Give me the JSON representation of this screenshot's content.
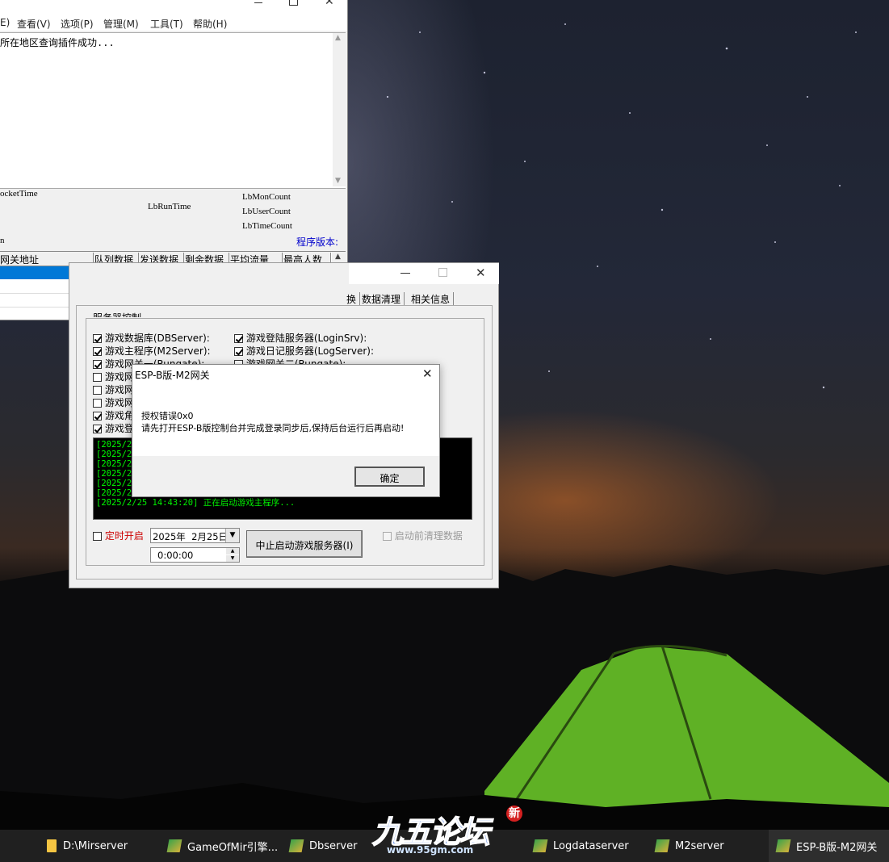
{
  "top_window": {
    "menu": [
      "E)",
      "查看(V)",
      "选项(P)",
      "管理(M)",
      "工具(T)",
      "帮助(H)"
    ],
    "log_line": "所在地区查询插件成功...",
    "info": {
      "socket_time": "ocketTime",
      "run_time": "LbRunTime",
      "mon_count": "LbMonCount",
      "user_count": "LbUserCount",
      "time_count": "LbTimeCount",
      "version_label": "程序版本:",
      "left_small": "n"
    },
    "table_headers": [
      "网关地址",
      "队列数据",
      "发送数据",
      "剩余数据",
      "平均流量",
      "最高人数"
    ]
  },
  "console_window": {
    "tabs": [
      "换",
      "数据清理",
      "相关信息"
    ],
    "group_title": "服务器控制",
    "left_checks": [
      {
        "label": "游戏数据库(DBServer):",
        "checked": true
      },
      {
        "label": "游戏主程序(M2Server):",
        "checked": true
      },
      {
        "label": "游戏网关一(Rungate):",
        "checked": true
      },
      {
        "label": "游戏网",
        "checked": false
      },
      {
        "label": "游戏网",
        "checked": false
      },
      {
        "label": "游戏网",
        "checked": false
      },
      {
        "label": "游戏角",
        "checked": true
      },
      {
        "label": "游戏登",
        "checked": true
      }
    ],
    "right_checks": [
      {
        "label": "游戏登陆服务器(LoginSrv):",
        "checked": true
      },
      {
        "label": "游戏日记服务器(LogServer):",
        "checked": true
      },
      {
        "label": "游戏网关二(Rungate):",
        "checked": false
      }
    ],
    "log_lines": [
      "[2025/2/",
      "[2025/2/",
      "[2025/2/",
      "[2025/2/",
      "[2025/2/",
      "[2025/2/",
      "[2025/2/25 14:43:20] 正在启动游戏主程序..."
    ],
    "timer_label": "定时开启",
    "date_value": "2025年  2月25日",
    "time_value": "0:00:00",
    "start_button": "中止启动游戏服务器(I)",
    "clear_label": "启动前清理数据"
  },
  "dialog": {
    "title": "ESP-B版-M2网关",
    "message_line1": "授权错误0x0",
    "message_line2": "请先打开ESP-B版控制台并完成登录同步后,保持后台运行后再启动!",
    "ok_button": "确定"
  },
  "taskbar": {
    "items": [
      {
        "label": "D:\\Mirserver",
        "icon": "folder-icon"
      },
      {
        "label": "GameOfMir引擎...",
        "icon": "app-icon"
      },
      {
        "label": "Dbserver",
        "icon": "app-icon"
      },
      {
        "label": "Logdataserver",
        "icon": "app-icon"
      },
      {
        "label": "M2server",
        "icon": "app-icon"
      },
      {
        "label": "ESP-B版-M2网关",
        "icon": "app-icon"
      }
    ],
    "watermark_text": "九五论坛",
    "watermark_url": "www.95gm.com",
    "watermark_badge": "新"
  },
  "colors": {
    "accent_blue": "#0078d7",
    "log_green": "#00ff00",
    "timer_red": "#cc0000",
    "version_blue": "#0000cc"
  }
}
